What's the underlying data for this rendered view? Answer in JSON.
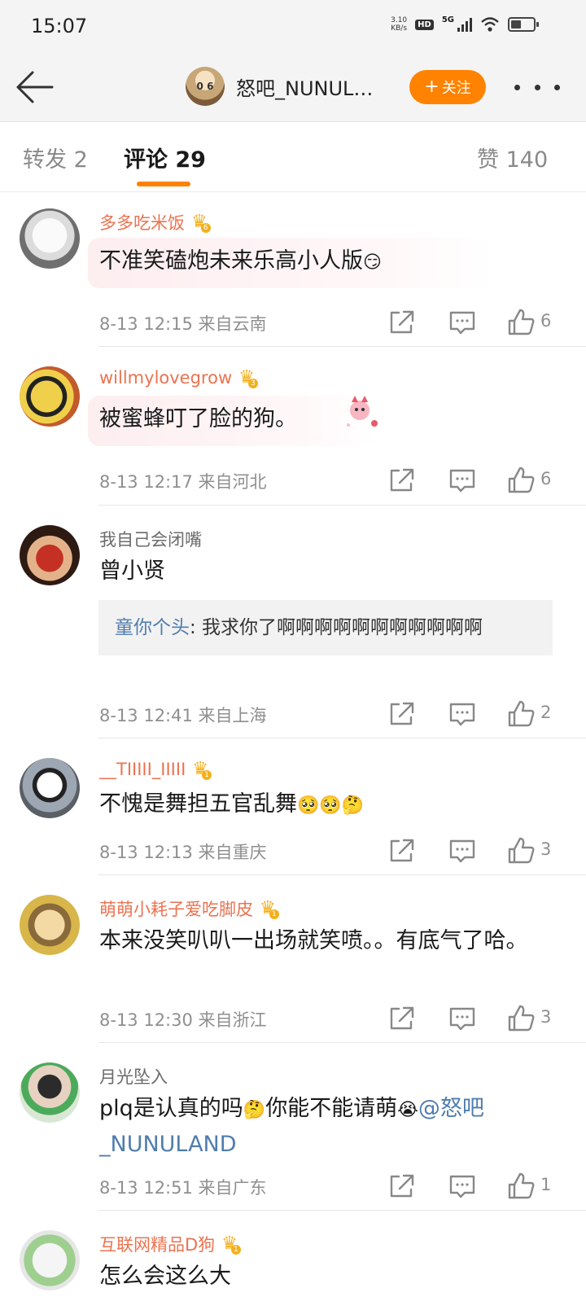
{
  "status_bar": {
    "time": "15:07",
    "net_speed_value": "3.10",
    "net_speed_unit": "KB/s",
    "hd_badge": "HD",
    "network_type": "5G"
  },
  "nav": {
    "title": "怒吧_NUNUL…",
    "avatar_text": "0 6",
    "follow_plus": "+",
    "follow_label": "关注"
  },
  "tabs": {
    "repost": "转发 2",
    "comments": "评论 29",
    "likes": "赞 140"
  },
  "comments": [
    {
      "user": "多多吃米饭",
      "text": "不准笑磕炮未来乐高小人版",
      "emoji": "😏",
      "time_location": "8-13 12:15  来自云南",
      "likes": "6"
    },
    {
      "user": "willmylovegrow",
      "text": "被蜜蜂叮了脸的狗。",
      "time_location": "8-13 12:17  来自河北",
      "likes": "6"
    },
    {
      "user": "我自己会闭嘴",
      "text": "曾小贤",
      "reply_user": "童你个头",
      "reply_text": ": 我求你了啊啊啊啊啊啊啊啊啊啊啊",
      "time_location": "8-13 12:41  来自上海",
      "likes": "2"
    },
    {
      "user": "__TIIIII_IIIII",
      "text": "不愧是舞担五官乱舞",
      "emoji": "🥺🥺🤔",
      "time_location": "8-13 12:13  来自重庆",
      "likes": "3"
    },
    {
      "user": "萌萌小耗子爱吃脚皮",
      "text": "本来没笑叭叭一出场就笑喷。。有底气了哈。",
      "time_location": "8-13 12:30  来自浙江",
      "likes": "3"
    },
    {
      "user": "月光坠入",
      "text_pre": "plq是认真的吗",
      "emoji_a": "🤔",
      "text_mid": "你能不能请萌",
      "emoji_b": "😭",
      "mention": "@怒吧_NUNULAND",
      "time_location": "8-13 12:51  来自广东",
      "likes": "1"
    },
    {
      "user": "互联网精品D狗",
      "text": "怎么会这么大"
    }
  ],
  "icons": {
    "back": "arrow-left-icon",
    "more": "more-dots-icon",
    "crown": "vip-crown-icon",
    "share": "share-icon",
    "comment": "comment-icon",
    "like": "thumbs-up-icon"
  },
  "colors": {
    "accent": "#ff8200",
    "vip_name": "#eb7350",
    "mention": "#507daf"
  }
}
